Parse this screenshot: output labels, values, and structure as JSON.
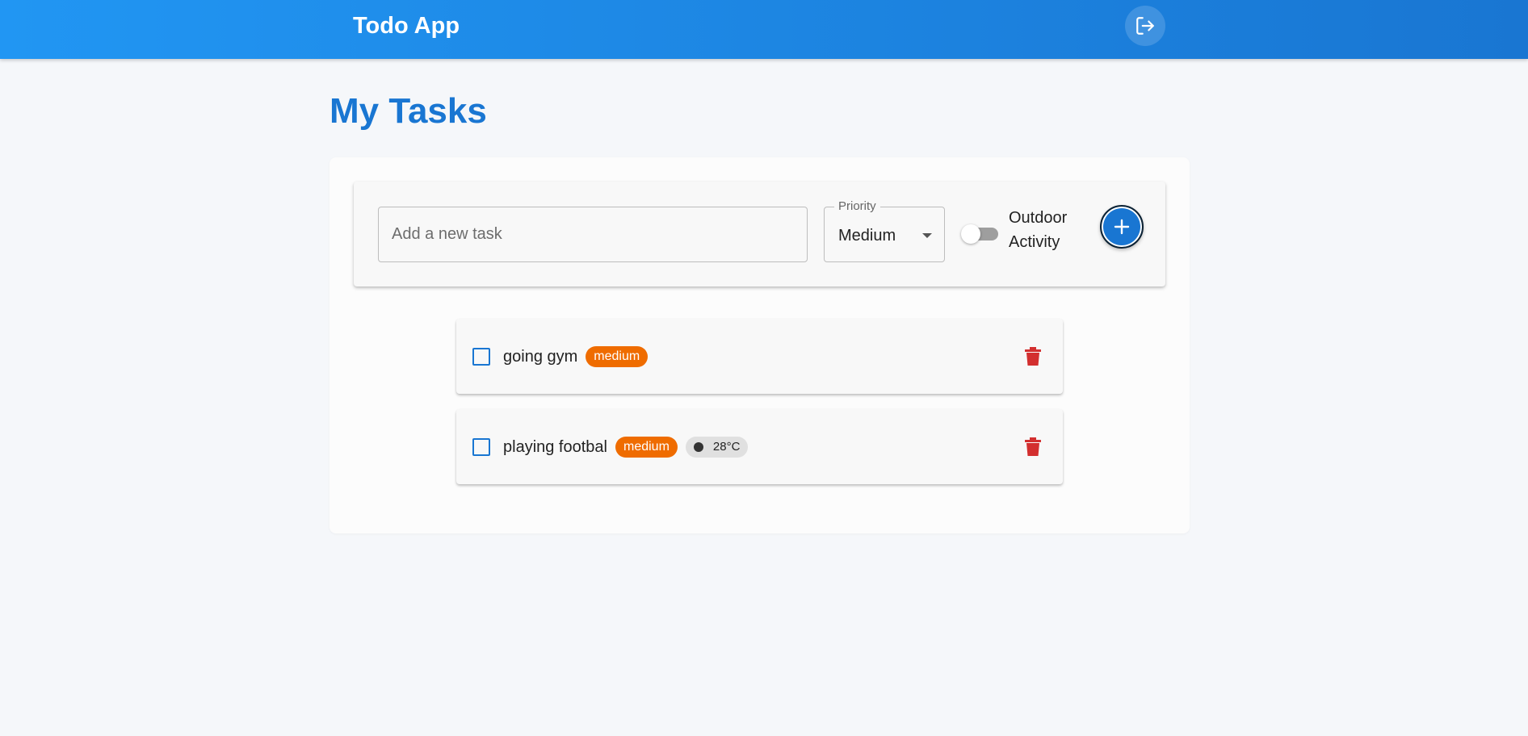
{
  "app": {
    "title": "Todo App",
    "logout_icon": "logout-icon"
  },
  "page": {
    "title": "My Tasks"
  },
  "add_form": {
    "task_input_value": "",
    "task_input_placeholder": "Add a new task",
    "priority_label": "Priority",
    "priority_value": "Medium",
    "outdoor_label": "Outdoor Activity",
    "outdoor_enabled": false,
    "add_icon": "plus-icon"
  },
  "tasks": [
    {
      "text": "going gym",
      "completed": false,
      "priority": "medium",
      "delete_icon": "trash-icon"
    },
    {
      "text": "playing footbal",
      "completed": false,
      "priority": "medium",
      "weather": "28°C",
      "delete_icon": "trash-icon"
    }
  ],
  "colors": {
    "primary": "#1976d2",
    "header_gradient_start": "#2196f3",
    "priority_medium": "#ef6c00",
    "delete": "#d32f2f",
    "background": "#f5f7fa"
  }
}
